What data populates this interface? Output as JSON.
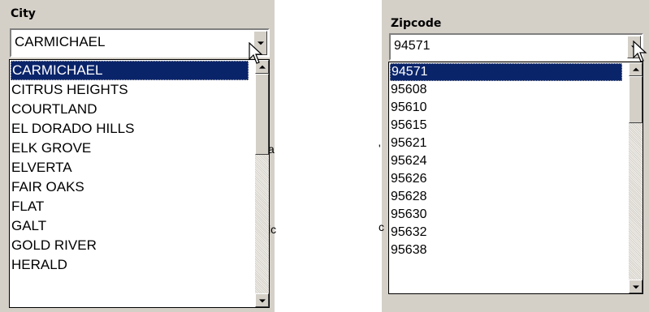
{
  "city": {
    "label": "City",
    "selected_value": "CARMICHAEL",
    "options": [
      "CARMICHAEL",
      "CITRUS HEIGHTS",
      "COURTLAND",
      "EL DORADO HILLS",
      "ELK GROVE",
      "ELVERTA",
      "FAIR OAKS",
      "FLAT",
      "GALT",
      "GOLD RIVER",
      "HERALD"
    ],
    "highlighted_index": 0
  },
  "zipcode": {
    "label": "Zipcode",
    "selected_value": "94571",
    "options": [
      "94571",
      "95608",
      "95610",
      "95615",
      "95621",
      "95624",
      "95626",
      "95628",
      "95630",
      "95632",
      "95638"
    ],
    "highlighted_index": 0
  },
  "colors": {
    "panel_bg": "#d4d0c8",
    "highlight_bg": "#0a246a",
    "highlight_text": "#ffffff"
  },
  "icons": [
    "dropdown-arrow-icon",
    "scroll-up-arrow-icon",
    "scroll-down-arrow-icon",
    "mouse-pointer-icon"
  ]
}
